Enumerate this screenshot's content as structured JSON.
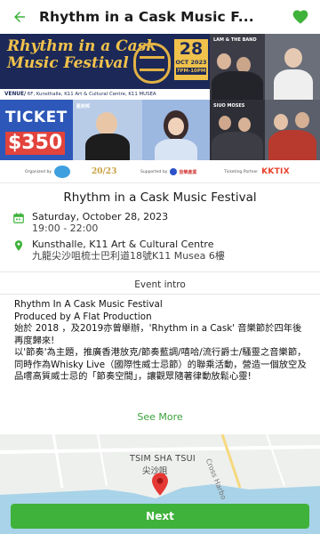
{
  "topbar": {
    "title": "Rhythm in a Cask Music F...",
    "back_icon": "arrow-left-icon",
    "favorite_icon": "heart-icon",
    "accent": "#3fb23b"
  },
  "banner": {
    "title_line1": "Rhythm in a Cask",
    "title_line2": "Music Festival",
    "date_day": "28",
    "date_month": "OCT 2023",
    "date_time": "7PM-10PM",
    "venue_label": "VENUE/",
    "venue_text": " 6F, Kunsthalle, K11 Art & Cultural Centre, K11 MUSEA",
    "ticket_label": "TICKET",
    "ticket_price": "$350",
    "artist_caption": "藍奕邦",
    "artist_caption2": "LAM & THE BAND",
    "artist_caption3": "SIUO MOSES"
  },
  "sponsors": {
    "organized_by": "Organized by",
    "supported_by": "Supported by",
    "supported_name": "音樂產業",
    "ticketing_partner": "Ticketing Partner",
    "ticketing_name": "KKTIX",
    "brand_mark": "20/23"
  },
  "event": {
    "title": "Rhythm in a Cask Music Festival",
    "date": "Saturday, October 28, 2023",
    "time": "19:00 - 22:00",
    "venue": "Kunsthalle, K11 Art & Cultural Centre",
    "address": "九龍尖沙咀梳士巴利道18號K11 Musea 6樓"
  },
  "intro": {
    "section_label": "Event intro",
    "line1": "Rhythm In A Cask Music Festival",
    "line2": "Produced by A Flat Production",
    "paragraph1": "始於 2018 ，及2019亦曾舉辦，'Rhythm in a Cask' 音樂節於四年後再度歸來!",
    "paragraph2": "以'節奏'為主題，推廣香港放克/節奏藍調/嘻哈/流行爵士/騷靈之音樂節，同時作為Whisky Live（國際性威士忌節）的聯乘活動，營造一個放空及品嚐高質威士忌的「節奏空間」，讓觀眾隨著律動放鬆心靈!",
    "see_more": "See More"
  },
  "map": {
    "label_en": "TSIM SHA TSUI",
    "label_zh": "尖沙咀",
    "road_label": "Cross Harbo",
    "pin_icon": "location-pin-icon"
  },
  "footer": {
    "next_label": "Next"
  }
}
